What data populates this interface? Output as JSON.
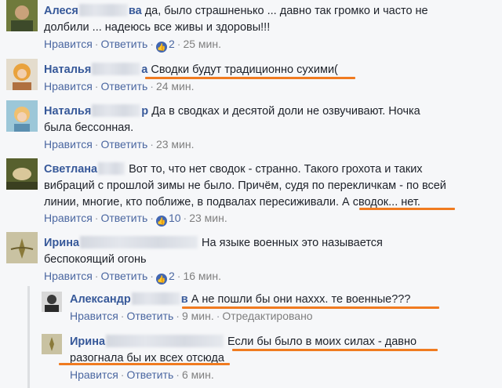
{
  "actions": {
    "like": "Нравится",
    "reply": "Ответить",
    "edited": "Отредактировано"
  },
  "comments": [
    {
      "name": "Алеся",
      "name_suffix": "ва",
      "line1": "да, было страшненько ... давно так громко и часто не",
      "line2": "долбили ... надеюсь все живы и здоровы!!!",
      "reactions": "2",
      "time": "25 мин."
    },
    {
      "name": "Наталья",
      "name_suffix": "а",
      "line1": "Сводки будут традиционно сухими(",
      "reactions": "",
      "time": "24 мин."
    },
    {
      "name": "Наталья",
      "name_suffix": "р",
      "line1": "Да в сводках и десятой доли не озвучивают. Ночка",
      "line2": "была бессонная.",
      "reactions": "",
      "time": "23 мин."
    },
    {
      "name": "Светлана",
      "name_suffix": "",
      "line1": "Вот то, что нет сводок - странно. Такого грохота и таких",
      "line2": "вибраций с прошлой зимы не было. Причём, судя по перекличкам - по всей",
      "line3a": "линии, многие, кто поближе, в подвалах пересиживали.",
      "line3b": "А сводок... нет.",
      "reactions": "10",
      "time": "23 мин."
    },
    {
      "name": "Ирина",
      "name_suffix": "",
      "line1": "На языке военных это называется",
      "line2": "беспокоящий огонь",
      "reactions": "2",
      "time": "16 мин."
    }
  ],
  "replies": [
    {
      "name": "Александр",
      "name_suffix": "в",
      "line1": "А не пошли бы они наххх. те военные???",
      "time": "9 мин."
    },
    {
      "name": "Ирина",
      "name_suffix": "",
      "line1": "Если бы было в моих силах - давно",
      "line2": "разогнала бы их всех отсюда",
      "time": "6 мин."
    }
  ],
  "colors": {
    "link": "#365899",
    "underline": "#f07b20",
    "meta": "#7f7f7f"
  }
}
